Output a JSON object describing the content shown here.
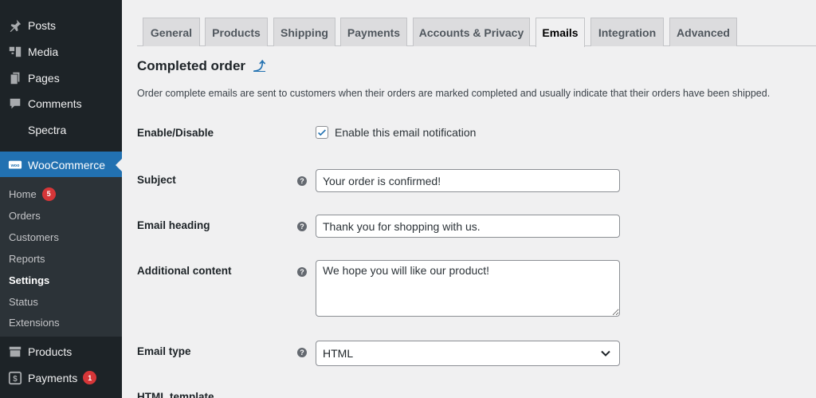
{
  "sidebar": {
    "items": [
      {
        "label": "Posts",
        "icon": "pin-icon"
      },
      {
        "label": "Media",
        "icon": "media-icon"
      },
      {
        "label": "Pages",
        "icon": "pages-icon"
      },
      {
        "label": "Comments",
        "icon": "comment-icon"
      },
      {
        "label": "Spectra",
        "icon": ""
      },
      {
        "label": "WooCommerce",
        "icon": "woo-icon"
      },
      {
        "label": "Products",
        "icon": "archive-icon"
      },
      {
        "label": "Payments",
        "icon": "dollar-icon",
        "badge": "1"
      }
    ],
    "submenu": [
      {
        "label": "Home",
        "badge": "5"
      },
      {
        "label": "Orders"
      },
      {
        "label": "Customers"
      },
      {
        "label": "Reports"
      },
      {
        "label": "Settings"
      },
      {
        "label": "Status"
      },
      {
        "label": "Extensions"
      }
    ],
    "active_color": "#2271b1",
    "badge_color": "#d63638"
  },
  "tabs": [
    "General",
    "Products",
    "Shipping",
    "Payments",
    "Accounts & Privacy",
    "Emails",
    "Integration",
    "Advanced"
  ],
  "active_tab": "Emails",
  "page": {
    "title": "Completed order",
    "up_link": "⤴",
    "description": "Order complete emails are sent to customers when their orders are marked completed and usually indicate that their orders have been shipped."
  },
  "form": {
    "enable_label": "Enable/Disable",
    "enable_checkbox_label": "Enable this email notification",
    "enable_checked": true,
    "subject_label": "Subject",
    "subject_value": "Your order is confirmed!",
    "heading_label": "Email heading",
    "heading_value": "Thank you for shopping with us.",
    "additional_label": "Additional content",
    "additional_value": "We hope you will like our product!",
    "type_label": "Email type",
    "type_value": "HTML",
    "template_label": "HTML template",
    "help_glyph": "?"
  }
}
